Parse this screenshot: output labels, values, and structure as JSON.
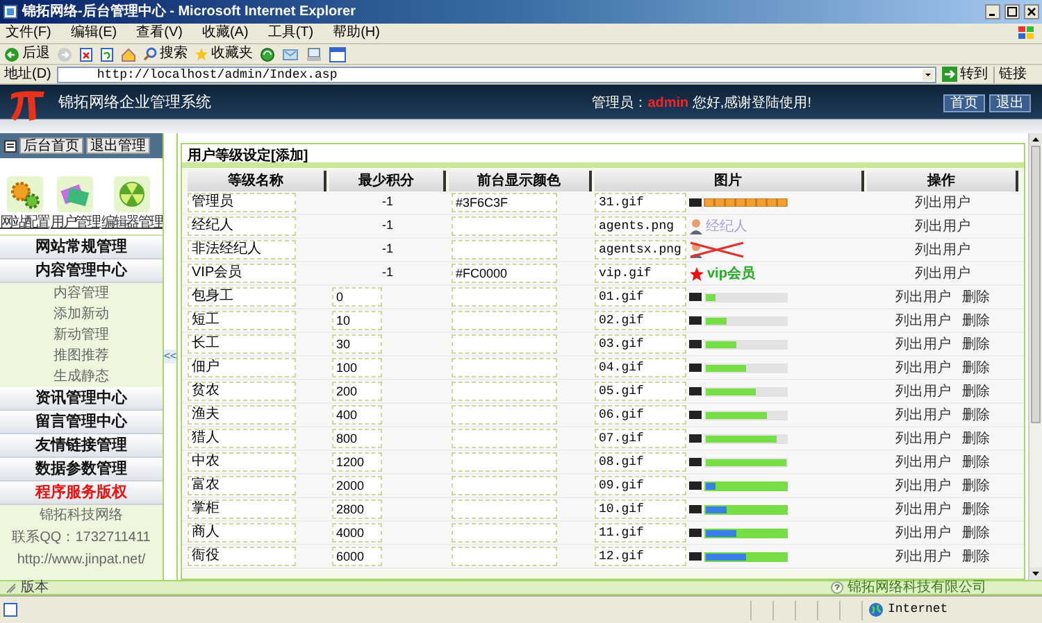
{
  "window": {
    "title": "锦拓网络-后台管理中心 - Microsoft Internet Explorer"
  },
  "menu": [
    "文件(F)",
    "编辑(E)",
    "查看(V)",
    "收藏(A)",
    "工具(T)",
    "帮助(H)"
  ],
  "toolbar": {
    "back": "后退",
    "search": "搜索",
    "favorites": "收藏夹"
  },
  "address_bar": {
    "label": "地址(D)",
    "value": "http://localhost/admin/Index.asp",
    "go": "转到",
    "links": "链接"
  },
  "header": {
    "title": "锦拓网络企业管理系统",
    "greeting_prefix": "管理员：",
    "user": "admin",
    "greeting_suffix": "您好,感谢登陆使用!",
    "buttons": [
      "首页",
      "退出"
    ]
  },
  "sidebar": {
    "top_buttons": [
      "后台首页",
      "退出管理"
    ],
    "shortcuts": [
      {
        "label": "网站配置",
        "kind": "gears"
      },
      {
        "label": "用户管理",
        "kind": "cards"
      },
      {
        "label": "编辑器管理",
        "kind": "ball"
      }
    ],
    "sections": [
      {
        "label": "网站常规管理",
        "highlight": false
      },
      {
        "label": "内容管理中心",
        "highlight": false,
        "children": [
          {
            "label": "内容管理"
          },
          {
            "label": "添加新动"
          },
          {
            "label": "新动管理"
          },
          {
            "label": "推图推荐"
          },
          {
            "label": "生成静态"
          }
        ]
      },
      {
        "label": "资讯管理中心",
        "highlight": false
      },
      {
        "label": "留言管理中心",
        "highlight": false
      },
      {
        "label": "友情链接管理",
        "highlight": false
      },
      {
        "label": "数据参数管理",
        "highlight": false
      },
      {
        "label": "程序服务版权",
        "highlight": true
      }
    ],
    "footer": [
      "锦拓科技网络",
      "联系QQ：1732711411",
      "http://www.jinpat.net/"
    ],
    "collapse": "<<"
  },
  "panel": {
    "title": "用户等级设定[添加]",
    "columns": [
      "等级名称",
      "最少积分",
      "前台显示颜色",
      "图片",
      "操作"
    ],
    "rows": [
      {
        "name": "管理员",
        "points": "-1",
        "points_editable": false,
        "color_value": "#3F6C3F",
        "image": "31.gif",
        "kind": "strip",
        "actions": [
          "列出用户"
        ]
      },
      {
        "name": "经纪人",
        "points": "-1",
        "points_editable": false,
        "image": "agents.png",
        "kind": "agent",
        "badge_text": "经纪人",
        "actions": [
          "列出用户"
        ]
      },
      {
        "name": "非法经纪人",
        "points": "-1",
        "points_editable": false,
        "image": "agentsx.png",
        "kind": "agent_banned",
        "actions": [
          "列出用户"
        ]
      },
      {
        "name": "VIP会员",
        "points": "-1",
        "points_editable": false,
        "color_value": "#FC0000",
        "image": "vip.gif",
        "kind": "vip",
        "badge_text": "vip会员",
        "actions": [
          "列出用户"
        ]
      },
      {
        "name": "包身工",
        "points": "0",
        "points_editable": true,
        "image": "01.gif",
        "kind": "green_bar",
        "level": 0.125,
        "actions": [
          "列出用户",
          "删除"
        ]
      },
      {
        "name": "短工",
        "points": "10",
        "points_editable": true,
        "image": "02.gif",
        "kind": "green_bar",
        "level": 0.25,
        "actions": [
          "列出用户",
          "删除"
        ]
      },
      {
        "name": "长工",
        "points": "30",
        "points_editable": true,
        "image": "03.gif",
        "kind": "green_bar",
        "level": 0.375,
        "actions": [
          "列出用户",
          "删除"
        ]
      },
      {
        "name": "佃户",
        "points": "100",
        "points_editable": true,
        "image": "04.gif",
        "kind": "green_bar",
        "level": 0.5,
        "actions": [
          "列出用户",
          "删除"
        ]
      },
      {
        "name": "贫农",
        "points": "200",
        "points_editable": true,
        "image": "05.gif",
        "kind": "green_bar",
        "level": 0.625,
        "actions": [
          "列出用户",
          "删除"
        ]
      },
      {
        "name": "渔夫",
        "points": "400",
        "points_editable": true,
        "image": "06.gif",
        "kind": "green_bar",
        "level": 0.75,
        "actions": [
          "列出用户",
          "删除"
        ]
      },
      {
        "name": "猎人",
        "points": "800",
        "points_editable": true,
        "image": "07.gif",
        "kind": "green_bar",
        "level": 0.875,
        "actions": [
          "列出用户",
          "删除"
        ]
      },
      {
        "name": "中农",
        "points": "1200",
        "points_editable": true,
        "image": "08.gif",
        "kind": "green_bar",
        "level": 1,
        "actions": [
          "列出用户",
          "删除"
        ]
      },
      {
        "name": "富农",
        "points": "2000",
        "points_editable": true,
        "image": "09.gif",
        "kind": "blue_bar",
        "level": 0.125,
        "actions": [
          "列出用户",
          "删除"
        ]
      },
      {
        "name": "掌柜",
        "points": "2800",
        "points_editable": true,
        "image": "10.gif",
        "kind": "blue_bar",
        "level": 0.25,
        "actions": [
          "列出用户",
          "删除"
        ]
      },
      {
        "name": "商人",
        "points": "4000",
        "points_editable": true,
        "image": "11.gif",
        "kind": "blue_bar",
        "level": 0.375,
        "actions": [
          "列出用户",
          "删除"
        ]
      },
      {
        "name": "衙役",
        "points": "6000",
        "points_editable": true,
        "image": "12.gif",
        "kind": "blue_bar",
        "level": 0.5,
        "actions": [
          "列出用户",
          "删除"
        ]
      }
    ]
  },
  "footer_bar": {
    "left": "版本",
    "right": "锦拓网络科技有限公司"
  },
  "status_bar": {
    "zone": "Internet"
  }
}
